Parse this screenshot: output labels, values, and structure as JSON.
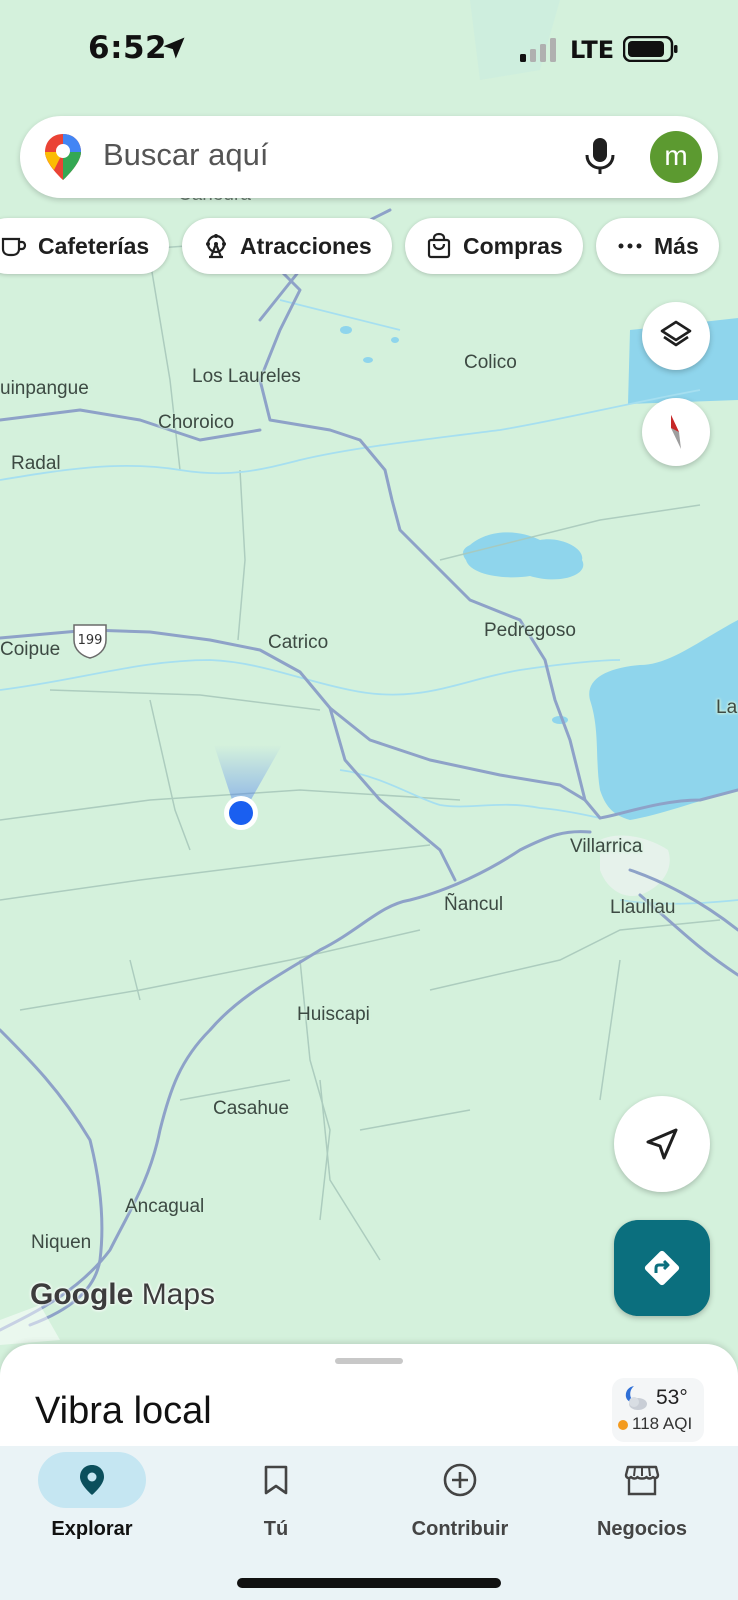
{
  "status_bar": {
    "time": "6:52",
    "network": "LTE",
    "location_icon": "location-arrow-icon",
    "signal_icon": "cell-signal-icon",
    "battery_icon": "battery-icon"
  },
  "search": {
    "placeholder": "Buscar aquí",
    "logo_icon": "maps-pin-logo-icon",
    "mic_icon": "microphone-icon",
    "avatar_letter": "m",
    "avatar_color": "#5c9a30"
  },
  "chips": [
    {
      "label": "Cafeterías",
      "icon": "coffee-cup-icon"
    },
    {
      "label": "Atracciones",
      "icon": "ferris-wheel-icon"
    },
    {
      "label": "Compras",
      "icon": "shopping-bag-icon"
    },
    {
      "label": "Más",
      "icon": "more-dots-icon"
    }
  ],
  "map": {
    "watermark_brand": "Google",
    "watermark_product": "Maps",
    "route_shield": "199",
    "land_color": "#d4f1dc",
    "water_color": "#8fd5ec",
    "road_color": "#8ea2c8",
    "places": [
      "Caneura",
      "Los Laureles",
      "Colico",
      "uinpangue",
      "Choroico",
      "Radal",
      "Coipue",
      "Catrico",
      "Pedregoso",
      "La",
      "Villarrica",
      "Ñancul",
      "Llaullau",
      "Huiscapi",
      "Casahue",
      "Ancagual",
      "Niquen"
    ]
  },
  "controls": {
    "layers_icon": "layers-icon",
    "compass_icon": "compass-icon",
    "my_location_icon": "navigation-arrow-icon",
    "directions_icon": "directions-icon",
    "directions_color": "#0b6f7e"
  },
  "sheet": {
    "title": "Vibra local",
    "weather_temp": "53°",
    "weather_aqi": "118 AQI",
    "weather_icon": "moon-cloud-icon"
  },
  "nav": [
    {
      "label": "Explorar",
      "icon": "pin-icon",
      "active": true
    },
    {
      "label": "Tú",
      "icon": "bookmark-icon",
      "active": false
    },
    {
      "label": "Contribuir",
      "icon": "add-circle-icon",
      "active": false
    },
    {
      "label": "Negocios",
      "icon": "storefront-icon",
      "active": false
    }
  ]
}
